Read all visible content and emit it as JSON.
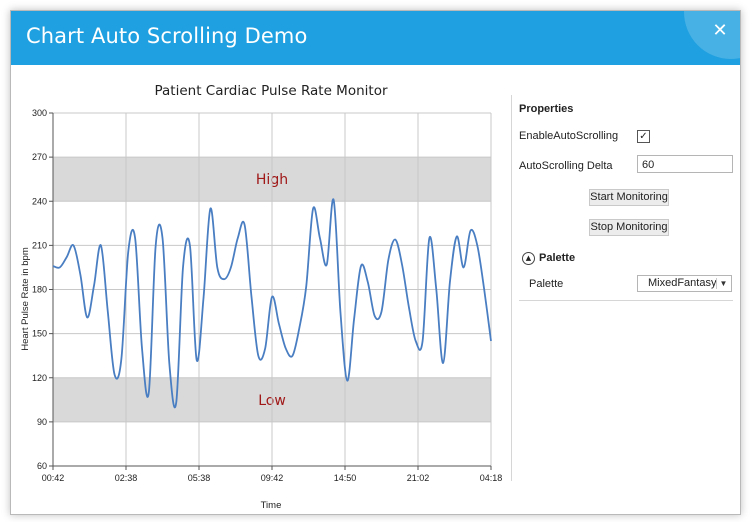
{
  "window": {
    "title": "Chart Auto Scrolling Demo",
    "close_glyph": "✕",
    "accent_color": "#1fa0e0"
  },
  "properties": {
    "header": "Properties",
    "enable_auto_scrolling_label": "EnableAutoScrolling",
    "enable_auto_scrolling_checked": true,
    "checkbox_glyph": "✓",
    "auto_scrolling_delta_label": "AutoScrolling Delta",
    "auto_scrolling_delta_value": "60",
    "start_button": "Start Monitoring",
    "stop_button": "Stop Monitoring",
    "palette_section": "Palette",
    "palette_expander_glyph": "▲",
    "palette_label": "Palette",
    "palette_value": "MixedFantasy",
    "palette_arrow_glyph": "▼"
  },
  "chart_data": {
    "type": "line",
    "title": "Patient Cardiac Pulse Rate Monitor",
    "xlabel": "Time",
    "ylabel": "Heart Pulse Rate in bpm",
    "ylim": [
      60,
      300
    ],
    "yticks": [
      "60",
      "90",
      "120",
      "150",
      "180",
      "210",
      "240",
      "270",
      "300"
    ],
    "xticks": [
      "00:42",
      "02:38",
      "05:38",
      "09:42",
      "14:50",
      "21:02",
      "04:18"
    ],
    "grid": true,
    "line_color": "#4a7ec2",
    "bands": [
      {
        "label": "High",
        "from": 240,
        "to": 270,
        "color": "#d9d9d9",
        "text_color": "#a01818"
      },
      {
        "label": "Low",
        "from": 90,
        "to": 120,
        "color": "#d9d9d9",
        "text_color": "#a01818"
      }
    ],
    "series": [
      {
        "values": [
          196,
          195,
          202,
          210,
          190,
          161,
          183,
          210,
          165,
          122,
          133,
          206,
          215,
          140,
          110,
          210,
          215,
          130,
          103,
          195,
          210,
          132,
          175,
          235,
          195,
          187,
          195,
          215,
          224,
          175,
          135,
          140,
          175,
          157,
          140,
          135,
          154,
          182,
          235,
          215,
          197,
          241,
          165,
          118,
          160,
          196,
          185,
          162,
          165,
          200,
          214,
          197,
          168,
          145,
          145,
          215,
          180,
          130,
          185,
          216,
          195,
          220,
          210,
          180,
          145
        ]
      }
    ]
  }
}
